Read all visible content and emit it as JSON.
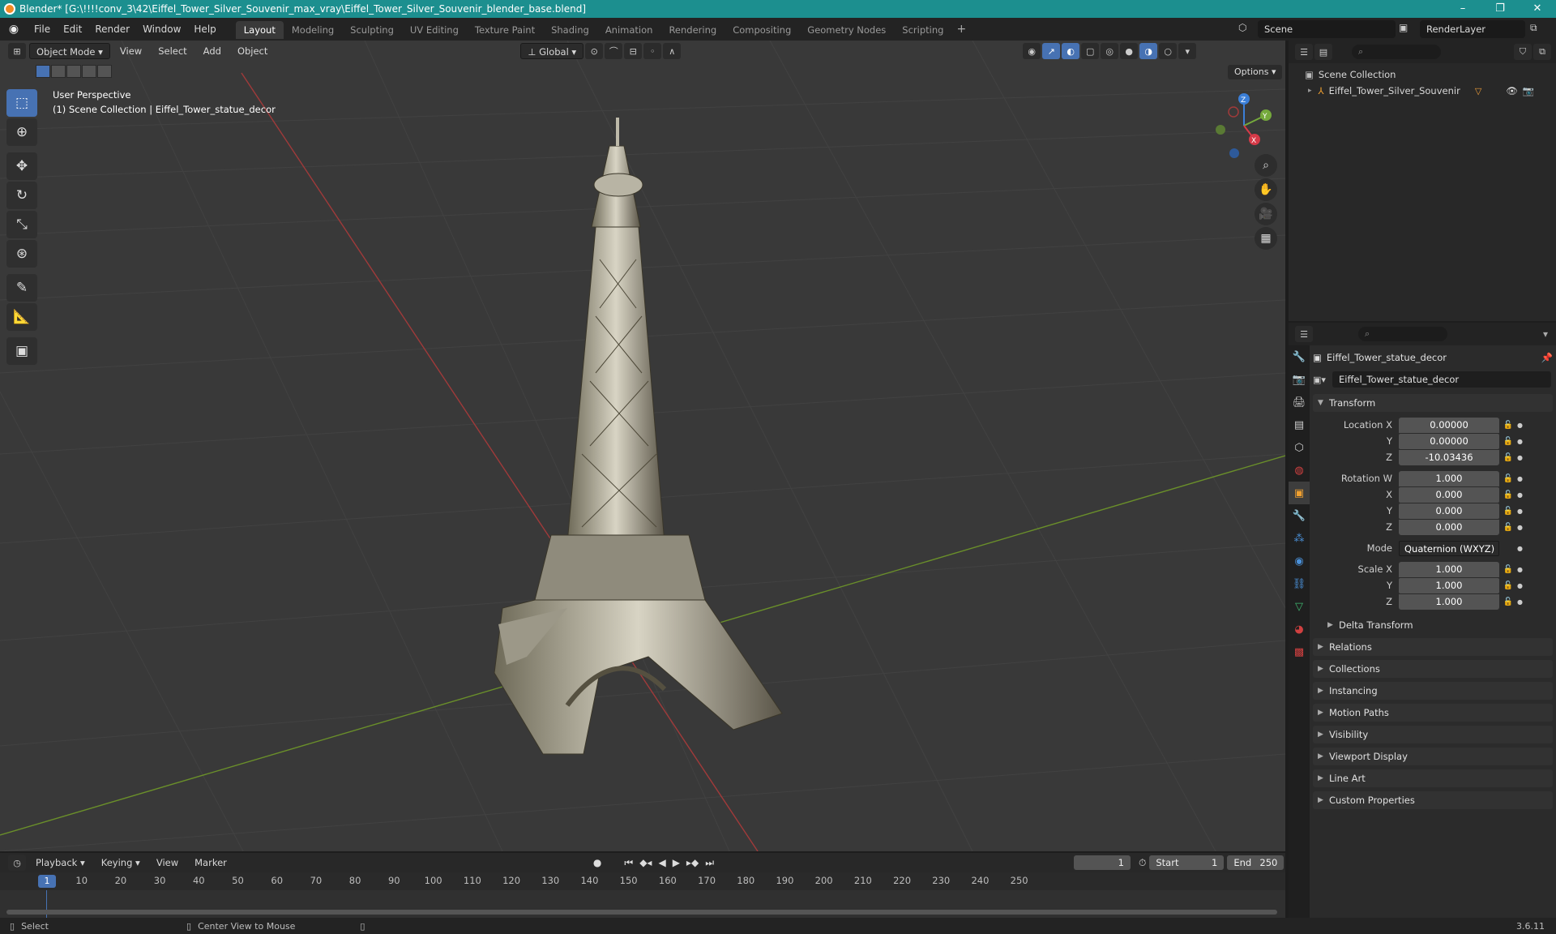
{
  "window": {
    "title": "Blender* [G:\\!!!!conv_3\\42\\Eiffel_Tower_Silver_Souvenir_max_vray\\Eiffel_Tower_Silver_Souvenir_blender_base.blend]",
    "min_icon": "–",
    "max_icon": "❐",
    "close_icon": "✕"
  },
  "menu": [
    "File",
    "Edit",
    "Render",
    "Window",
    "Help"
  ],
  "workspaces": [
    "Layout",
    "Modeling",
    "Sculpting",
    "UV Editing",
    "Texture Paint",
    "Shading",
    "Animation",
    "Rendering",
    "Compositing",
    "Geometry Nodes",
    "Scripting"
  ],
  "active_workspace": "Layout",
  "scene_name": "Scene",
  "render_layer": "RenderLayer",
  "viewport": {
    "mode": "Object Mode",
    "menus": [
      "View",
      "Select",
      "Add",
      "Object"
    ],
    "transform_orientation": "Global",
    "options_label": "Options",
    "perspective_label": "User Perspective",
    "collection_label": "(1) Scene Collection | Eiffel_Tower_statue_decor",
    "gizmo": {
      "x": "X",
      "y": "Y",
      "z": "Z"
    }
  },
  "outliner": {
    "root": "Scene Collection",
    "item": "Eiffel_Tower_Silver_Souvenir"
  },
  "properties": {
    "object_name": "Eiffel_Tower_statue_decor",
    "datablock_name": "Eiffel_Tower_statue_decor",
    "transform_label": "Transform",
    "location": {
      "label": "Location X",
      "x": "0.00000",
      "y": "0.00000",
      "z": "-10.03436"
    },
    "rotation": {
      "label": "Rotation W",
      "w": "1.000",
      "x": "0.000",
      "y": "0.000",
      "z": "0.000"
    },
    "mode_label": "Mode",
    "mode_value": "Quaternion (WXYZ)",
    "scale": {
      "label": "Scale X",
      "x": "1.000",
      "y": "1.000",
      "z": "1.000"
    },
    "axis_y": "Y",
    "axis_z": "Z",
    "axis_x": "X",
    "delta_transform": "Delta Transform",
    "sections": [
      "Relations",
      "Collections",
      "Instancing",
      "Motion Paths",
      "Visibility",
      "Viewport Display",
      "Line Art",
      "Custom Properties"
    ]
  },
  "timeline": {
    "menus": [
      "Playback",
      "Keying",
      "View",
      "Marker"
    ],
    "current_frame": "1",
    "start_label": "Start",
    "start": "1",
    "end_label": "End",
    "end": "250",
    "ticks": [
      "10",
      "20",
      "30",
      "40",
      "50",
      "60",
      "70",
      "80",
      "90",
      "100",
      "110",
      "120",
      "130",
      "140",
      "150",
      "160",
      "170",
      "180",
      "190",
      "200",
      "210",
      "220",
      "230",
      "240",
      "250"
    ]
  },
  "status": {
    "select": "Select",
    "center": "Center View to Mouse",
    "version": "3.6.11"
  },
  "colors": {
    "titlebar": "#1c8f8f",
    "accent": "#4772b3",
    "viewport_bg": "#393939",
    "axis_x": "#a03a3a",
    "axis_y": "#6a8f2a"
  }
}
